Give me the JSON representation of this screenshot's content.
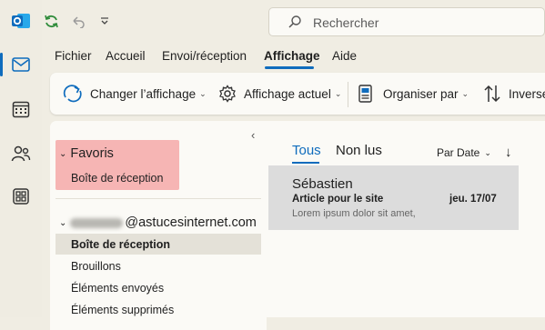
{
  "titlebar": {
    "search_placeholder": "Rechercher"
  },
  "menu": {
    "items": [
      "Fichier",
      "Accueil",
      "Envoi/réception",
      "Affichage",
      "Aide"
    ],
    "active": "Affichage"
  },
  "ribbon": {
    "change_view": "Changer l’affichage",
    "current_view": "Affichage actuel",
    "arrange_by": "Organiser par",
    "reverse": "Inverse"
  },
  "folders": {
    "favorites_header": "Favoris",
    "favorites_items": [
      "Boîte de réception"
    ],
    "account_suffix": "@astucesinternet.com",
    "account_items": [
      "Boîte de réception",
      "Brouillons",
      "Éléments envoyés",
      "Éléments supprimés"
    ],
    "selected": "Boîte de réception"
  },
  "message_list": {
    "tabs": [
      "Tous",
      "Non lus"
    ],
    "active_tab": "Tous",
    "sort_label": "Par Date",
    "sort_direction": "↓",
    "messages": [
      {
        "sender": "Sébastien",
        "subject": "Article pour le site",
        "date": "jeu. 17/07",
        "preview": "Lorem ipsum dolor sit amet,"
      }
    ]
  },
  "colors": {
    "accent": "#0f6cbd",
    "favorites_highlight": "#f4a8a8",
    "app_background": "#f0ede3"
  },
  "icons": {
    "rail": [
      "outlook-logo",
      "mail-icon",
      "calendar-icon",
      "people-icon",
      "apps-icon"
    ],
    "quick_access": [
      "sync-icon",
      "undo-icon",
      "customize-chevron-icon"
    ]
  }
}
